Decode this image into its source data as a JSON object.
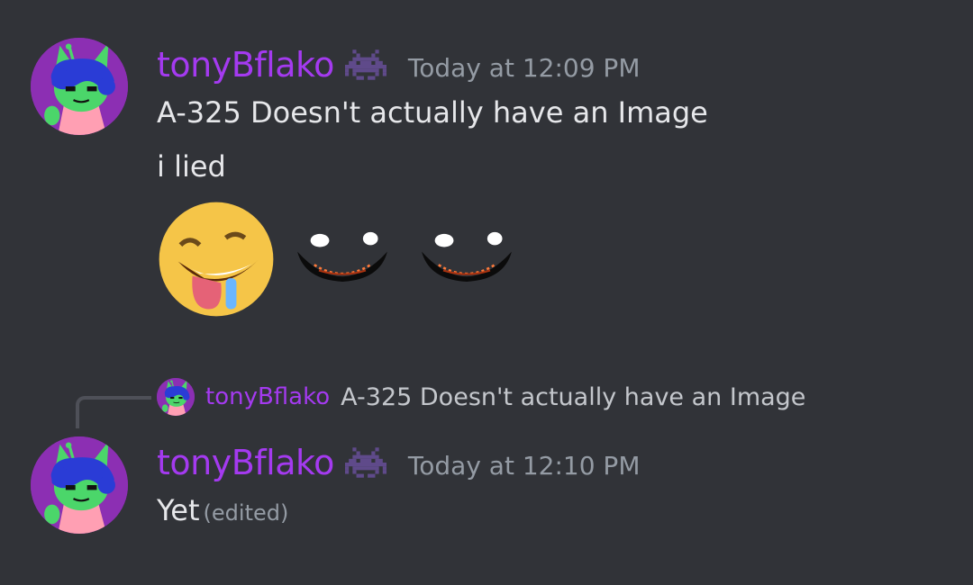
{
  "messages": [
    {
      "username": "tonyBflako",
      "timestamp": "Today at 12:09 PM",
      "lines": [
        "A-325 Doesn't actually have an Image",
        "i lied"
      ],
      "emojis": [
        "drooling-face-emoji",
        "evil-grin-emoji",
        "evil-grin-emoji"
      ]
    },
    {
      "reply": {
        "username": "tonyBflako",
        "text": "A-325 Doesn't actually have an Image"
      },
      "username": "tonyBflako",
      "timestamp": "Today at 12:10 PM",
      "text": "Yet",
      "edited_label": "(edited)"
    }
  ],
  "colors": {
    "background": "#313338",
    "username": "#a43af0",
    "timestamp": "#949ba4",
    "avatar_bg": "#8c2fb3"
  },
  "icons": {
    "badge": "space-invader-badge-icon"
  }
}
